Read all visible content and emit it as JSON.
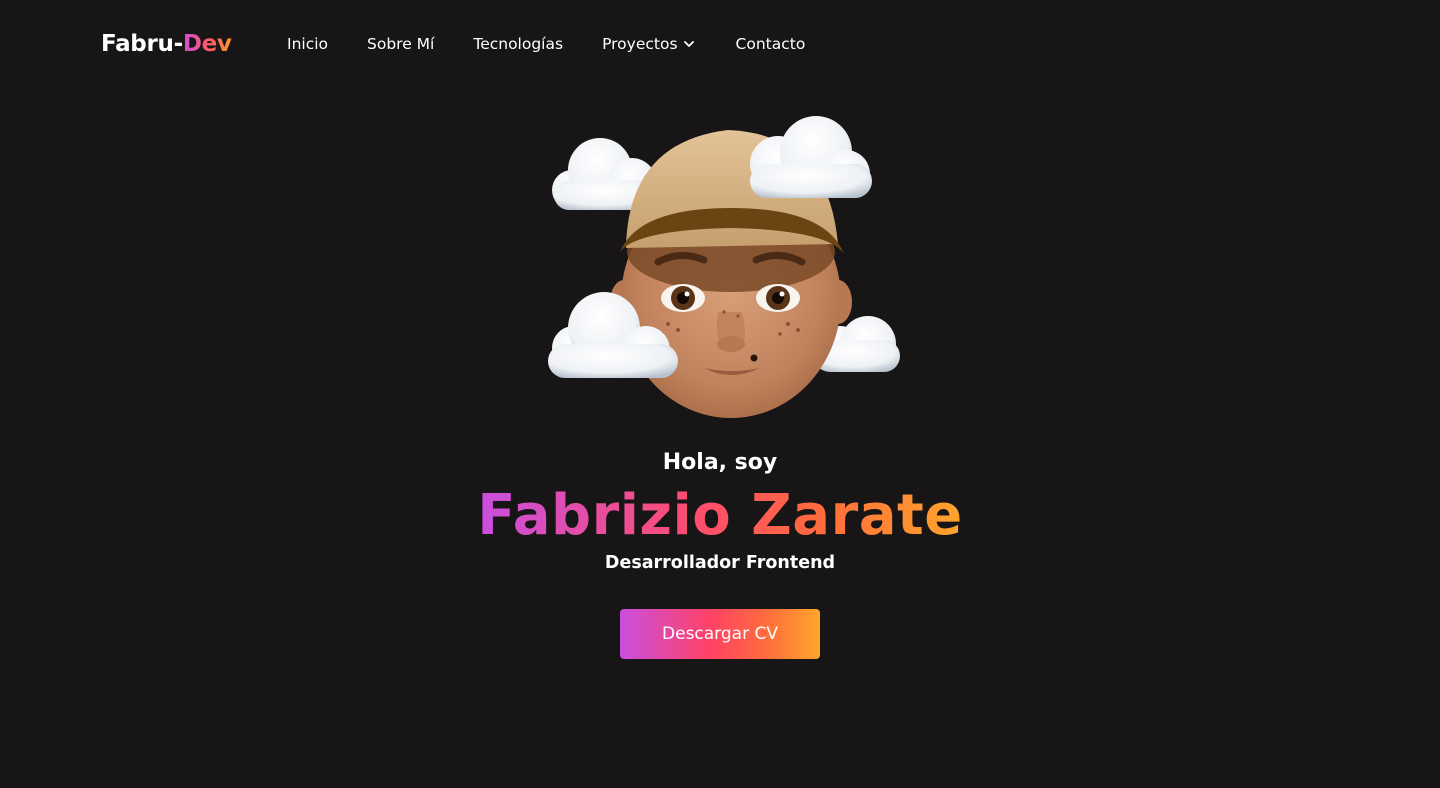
{
  "nav": {
    "logo_prefix": "Fabru-",
    "logo_accent": "Dev",
    "links": [
      {
        "label": "Inicio"
      },
      {
        "label": "Sobre Mí"
      },
      {
        "label": "Tecnologías"
      },
      {
        "label": "Proyectos",
        "icon": "chevron-down-icon"
      },
      {
        "label": "Contacto"
      }
    ]
  },
  "hero": {
    "avatar_icon": "memoji-avatar-with-clouds",
    "greeting": "Hola, soy",
    "name": "Fabrizio Zarate",
    "role": "Desarrollador Frontend",
    "cta_label": "Descargar CV"
  },
  "colors": {
    "background": "#171515",
    "text": "#ffffff",
    "gradient_start": "#c94fe0",
    "gradient_mid": "#ff4266",
    "gradient_end": "#ffa62b"
  }
}
